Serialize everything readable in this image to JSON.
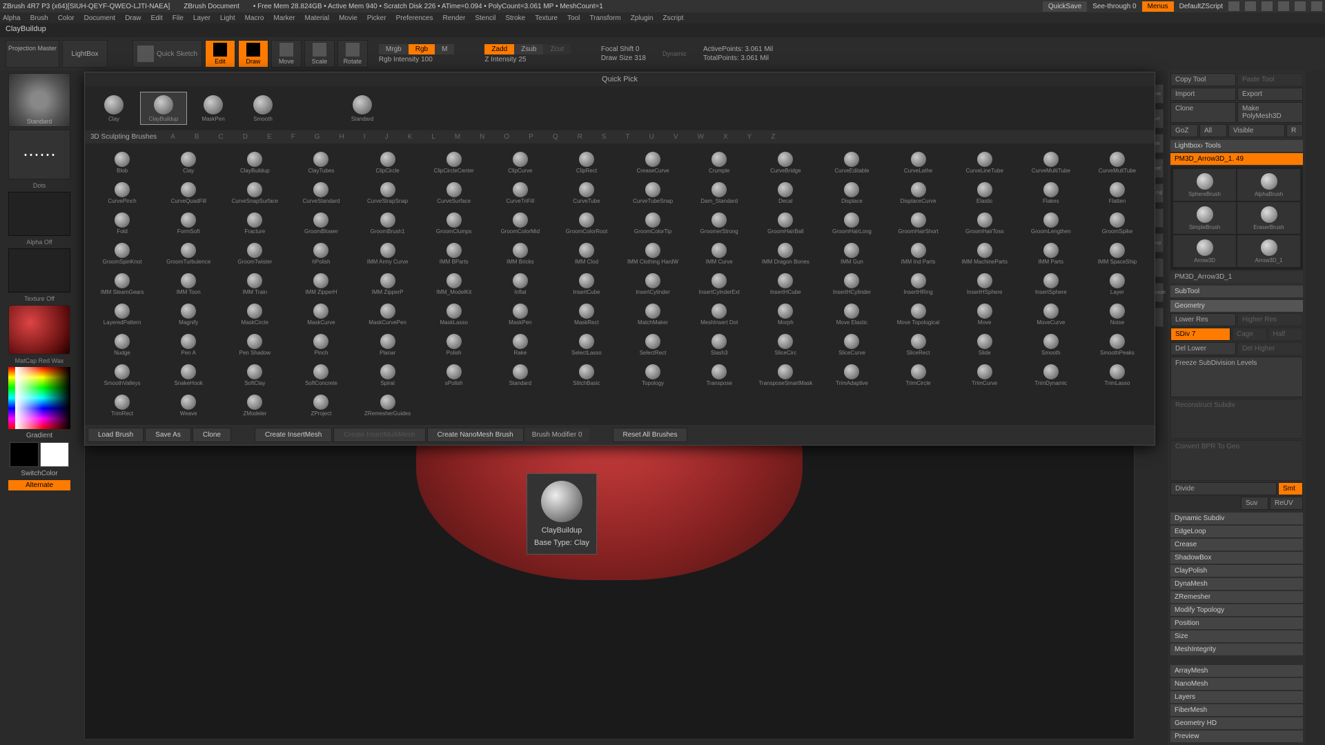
{
  "title": "ZBrush 4R7 P3  (x64)[SIUH-QEYF-QWEO-LJTI-NAEA]",
  "doc": "ZBrush Document",
  "mem_stats": "• Free Mem 28.824GB  • Active Mem 940  • Scratch Disk 226  • ATime=0.094  • PolyCount=3.061 MP  • MeshCount=1",
  "quicksave": "QuickSave",
  "seethrough": "See-through  0",
  "menus_btn": "Menus",
  "default_zs": "DefaultZScript",
  "menu": [
    "Alpha",
    "Brush",
    "Color",
    "Document",
    "Draw",
    "Edit",
    "File",
    "Layer",
    "Light",
    "Macro",
    "Marker",
    "Material",
    "Movie",
    "Picker",
    "Preferences",
    "Render",
    "Stencil",
    "Stroke",
    "Texture",
    "Tool",
    "Transform",
    "Zplugin",
    "Zscript"
  ],
  "tool_name": "ClayBuildup",
  "proj": "Projection Master",
  "lightbox": "LightBox",
  "qsketch": "Quick Sketch",
  "edit": "Edit",
  "draw": "Draw",
  "move": "Move",
  "scale": "Scale",
  "rotate": "Rotate",
  "mrgb": "Mrgb",
  "rgb": "Rgb",
  "m": "M",
  "rgb_int": "Rgb Intensity 100",
  "zadd": "Zadd",
  "zsub": "Zsub",
  "zcut": "Zcut",
  "zint": "Z Intensity 25",
  "fshift": "Focal Shift 0",
  "dsize": "Draw Size 318",
  "dynamic": "Dynamic",
  "activepoints": "ActivePoints: 3.061 Mil",
  "totalpoints": "TotalPoints: 3.061 Mil",
  "brush_std": "Standard",
  "dots": "Dots",
  "alpha_off": "Alpha Off",
  "tex_off": "Texture Off",
  "matred": "MatCap Red Wax",
  "gradient": "Gradient",
  "switchcolor": "SwitchColor",
  "alternate": "Alternate",
  "popup_title": "Quick Pick",
  "qp": [
    "Clay",
    "ClayBuildup",
    "MaskPen",
    "Smooth",
    "",
    "Standard"
  ],
  "sect": "3D Sculpting Brushes",
  "alphabet": [
    "A",
    "B",
    "C",
    "D",
    "E",
    "F",
    "G",
    "H",
    "I",
    "J",
    "K",
    "L",
    "M",
    "N",
    "O",
    "P",
    "Q",
    "R",
    "S",
    "T",
    "U",
    "V",
    "W",
    "X",
    "Y",
    "Z"
  ],
  "brushes": [
    [
      "Blob",
      "Clay",
      "ClayBuildup",
      "ClayTubes",
      "ClipCircle",
      "ClipCircleCenter",
      "ClipCurve",
      "ClipRect",
      "CreaseCurve",
      "Crumple",
      "CurveBridge",
      "CurveEditable",
      "CurveLathe",
      "CurveLineTube",
      "CurveMultiTube",
      "CurveMultTube"
    ],
    [
      "CurvePinch",
      "CurveQuadFill",
      "CurveSnapSurface",
      "CurveStandard",
      "CurveStrapSnap",
      "CurveSurface",
      "CurveTriFill",
      "CurveTube",
      "CurveTubeSnap",
      "Dam_Standard",
      "Decal",
      "Displace",
      "DisplaceCurve",
      "Elastic",
      "Flakes",
      "Flatten"
    ],
    [
      "Fold",
      "FormSoft",
      "Fracture",
      "GroomBlower",
      "GroomBrush1",
      "GroomClumps",
      "GroomColorMid",
      "GroomColorRoot",
      "GroomColorTip",
      "GroomerStrong",
      "GroomHairBall",
      "GroomHairLong",
      "GroomHairShort",
      "GroomHairToss",
      "GroomLengthen",
      "GroomSpike"
    ],
    [
      "GroomSpinKnot",
      "GroomTurbulence",
      "GroomTwister",
      "hPolish",
      "IMM Army Curve",
      "IMM BParts",
      "IMM Bricks",
      "IMM Clod",
      "IMM Clothing HardW",
      "IMM Curve",
      "IMM Dragon Bones",
      "IMM Gun",
      "IMM Ind Parts",
      "IMM MachineParts",
      "IMM Parts",
      "IMM SpaceShip"
    ],
    [
      "IMM SteamGears",
      "IMM Toon",
      "IMM Train",
      "IMM ZipperH",
      "IMM ZipperP",
      "IMM_ModelKit",
      "Inflat",
      "InsertCube",
      "InsertCylinder",
      "InsertCylnderExt",
      "InsertHCube",
      "InsertHCylinder",
      "InsertHRing",
      "InsertHSphere",
      "InsertSphere",
      "Layer"
    ],
    [
      "LayeredPattern",
      "Magnify",
      "MaskCircle",
      "MaskCurve",
      "MaskCurvePen",
      "MaskLasso",
      "MaskPen",
      "MaskRect",
      "MatchMaker",
      "MeshInsert Dot",
      "Morph",
      "Move Elastic",
      "Move Topological",
      "Move",
      "MoveCurve",
      "Noise"
    ],
    [
      "Nudge",
      "Pen A",
      "Pen Shadow",
      "Pinch",
      "Planar",
      "Polish",
      "Rake",
      "SelectLasso",
      "SelectRect",
      "Slash3",
      "SliceCirc",
      "SliceCurve",
      "SliceRect",
      "Slide",
      "Smooth",
      "SmoothPeaks"
    ],
    [
      "SmoothValleys",
      "SnakeHook",
      "SoftClay",
      "SoftConcrete",
      "Spiral",
      "sPolish",
      "Standard",
      "StitchBasic",
      "Topology",
      "Transpose",
      "TransposeSmartMask",
      "TrimAdaptive",
      "TrimCircle",
      "TrimCurve",
      "TrimDynamic",
      "TrimLasso"
    ],
    [
      "TrimRect",
      "Weave",
      "ZModeler",
      "ZProject",
      "ZRemesherGuides",
      "",
      "",
      "",
      "",
      "",
      "",
      "",
      "",
      "",
      "",
      ""
    ]
  ],
  "footer": {
    "load": "Load Brush",
    "save": "Save As",
    "clone": "Clone",
    "cim": "Create InsertMesh",
    "cimm": "Create InsertMultiMesh",
    "cnm": "Create NanoMesh Brush",
    "bm": "Brush Modifier 0",
    "reset": "Reset All Brushes"
  },
  "tooltip": {
    "name": "ClayBuildup",
    "base": "Base Type: Clay"
  },
  "rp": {
    "copy": "Copy Tool",
    "paste": "Paste Tool",
    "import": "Import",
    "export": "Export",
    "clone": "Clone",
    "make": "Make PolyMesh3D",
    "goz": "GoZ",
    "all": "All",
    "visible": "Visible",
    "r": "R",
    "lbt": "Lightbox› Tools",
    "pm3d": "PM3D_Arrow3D_1. 49",
    "tools": [
      "SphereBrush",
      "AlphaBrush",
      "SimpleBrush",
      "EraserBrush",
      "Arrow3D",
      "Arrow3D_1"
    ],
    "pm3d2": "PM3D_Arrow3D_1",
    "subtool": "SubTool",
    "geometry": "Geometry",
    "lowres": "Lower Res",
    "highres": "Higher Res",
    "sdiv": "SDiv 7",
    "cage": "Cage",
    "half": "Half",
    "dellow": "Del Lower",
    "delhigh": "Del Higher",
    "freeze": "Freeze SubDivision Levels",
    "recon": "Reconstruct Subdiv",
    "conv": "Convert BPR To Geo",
    "divide": "Divide",
    "smt": "Smt",
    "suv": "Suv",
    "reuv": "ReUV",
    "items": [
      "Dynamic Subdiv",
      "EdgeLoop",
      "Crease",
      "ShadowBox",
      "ClayPolish",
      "DynaMesh",
      "ZRemesher",
      "Modify Topology",
      "Position",
      "Size",
      "MeshIntegrity"
    ],
    "items2": [
      "ArrayMesh",
      "NanoMesh",
      "Layers",
      "FiberMesh",
      "Geometry HD",
      "Preview"
    ]
  },
  "shelf": [
    "Frame",
    "Move",
    "Scale",
    "Rotate",
    "Line Fill",
    "",
    "Transp",
    "",
    "Dynamesh",
    ""
  ]
}
